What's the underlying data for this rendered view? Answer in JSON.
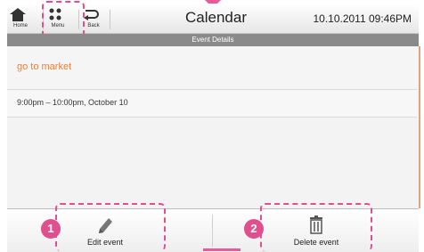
{
  "topbar": {
    "home_label": "Home",
    "menu_label": "Menu",
    "back_label": "Back",
    "title": "Calendar",
    "datetime": "10.10.2011 09:46PM"
  },
  "section": {
    "header": "Event Details"
  },
  "event": {
    "title": "go to market",
    "time": "9:00pm – 10:00pm, October 10"
  },
  "actions": {
    "edit_label": "Edit event",
    "delete_label": "Delete event",
    "edit_badge": "1",
    "delete_badge": "2"
  },
  "colors": {
    "accent": "#e0508e",
    "event_title": "#e8823e",
    "section_header_bg": "#8a8a8a"
  },
  "icons": {
    "home": "home-icon",
    "menu": "menu-grid-icon",
    "back": "back-arrow-icon",
    "edit": "pencil-icon",
    "delete": "trash-icon"
  }
}
